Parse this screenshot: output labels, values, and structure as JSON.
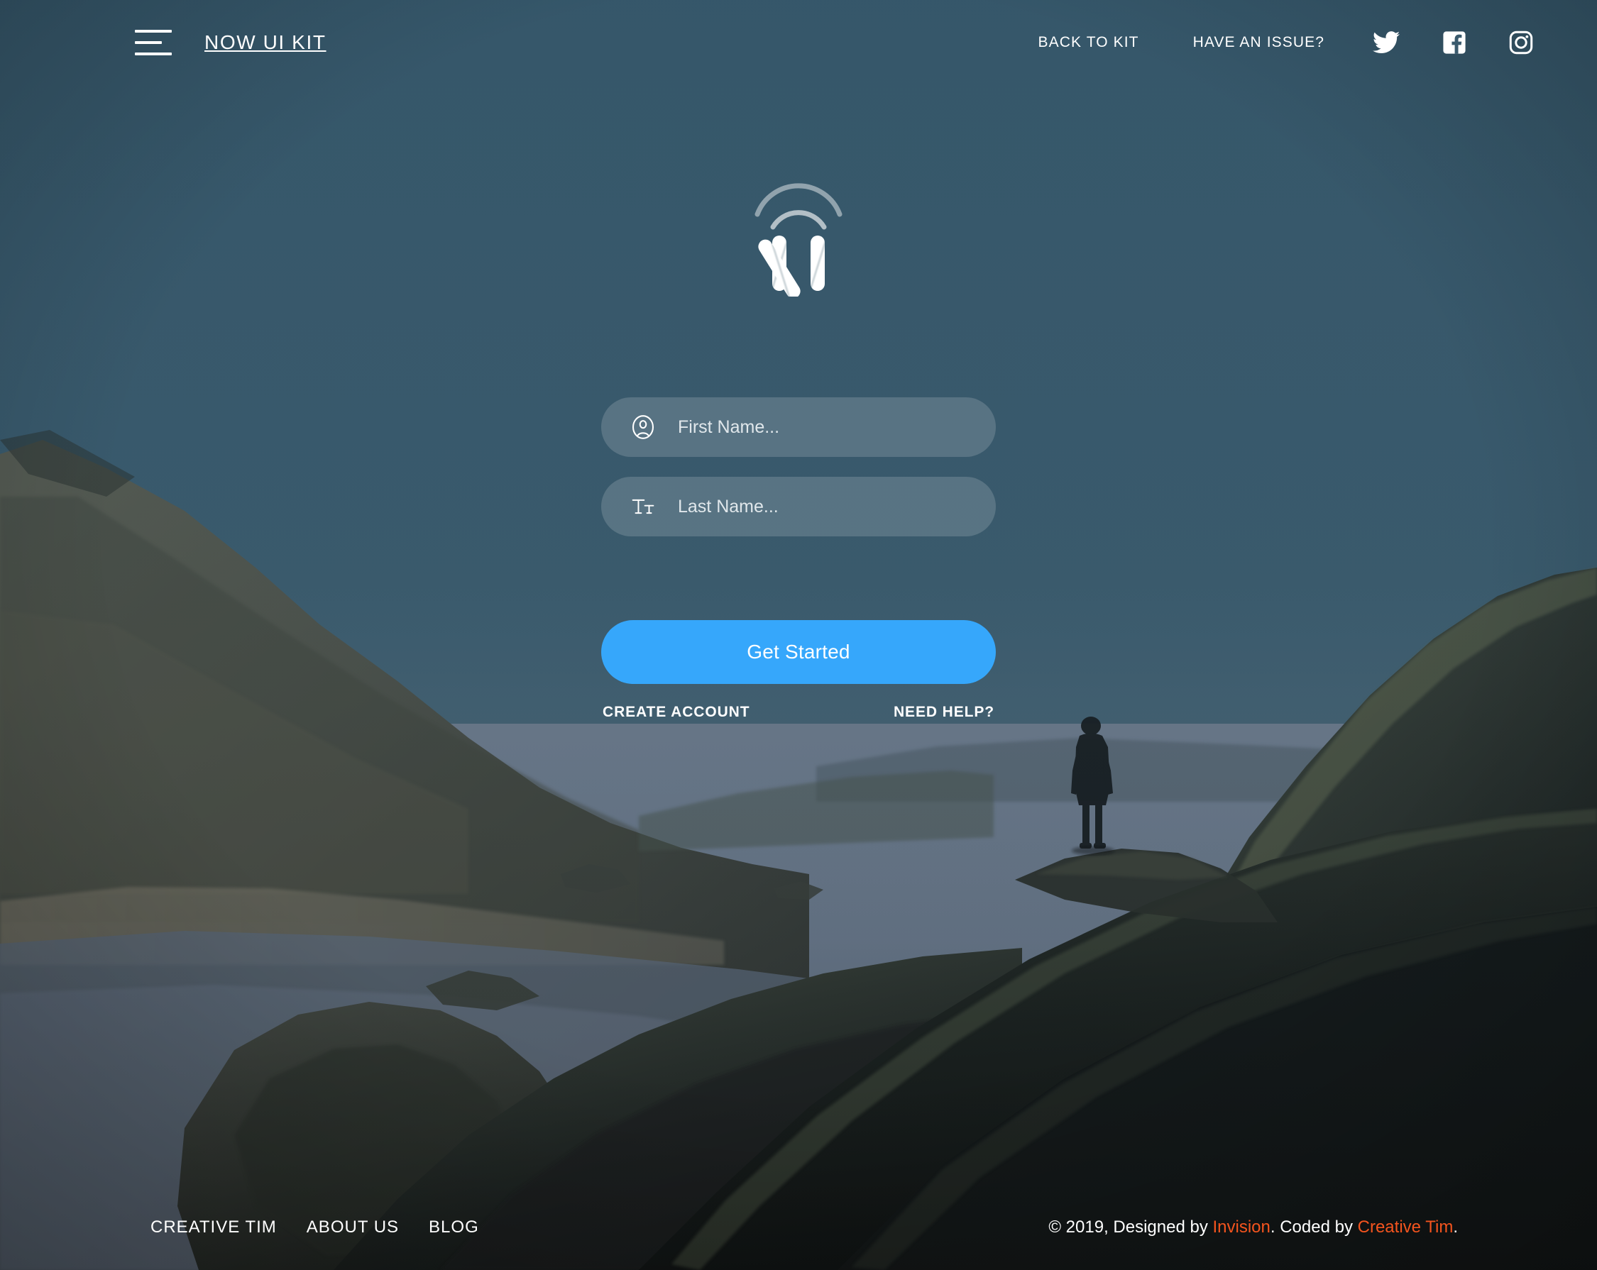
{
  "navbar": {
    "brand": "NOW UI KIT",
    "menu_icon": "hamburger-icon",
    "links": [
      {
        "label": "BACK TO KIT"
      },
      {
        "label": "HAVE AN ISSUE?"
      }
    ],
    "social": [
      {
        "name": "twitter-icon"
      },
      {
        "name": "facebook-icon"
      },
      {
        "name": "instagram-icon"
      }
    ]
  },
  "logo": {
    "name": "now-ui-kit-logo",
    "letter": "N"
  },
  "form": {
    "first_name": {
      "placeholder": "First Name...",
      "value": "",
      "icon": "user-circle-icon"
    },
    "last_name": {
      "placeholder": "Last Name...",
      "value": "",
      "icon": "text-format-icon"
    },
    "submit_label": "Get Started",
    "submit_color": "#36a7fb",
    "links": [
      {
        "label": "CREATE ACCOUNT"
      },
      {
        "label": "NEED HELP?"
      }
    ]
  },
  "footer": {
    "links": [
      {
        "label": "CREATIVE TIM"
      },
      {
        "label": "ABOUT US"
      },
      {
        "label": "BLOG"
      }
    ],
    "copyright": {
      "prefix": "© 2019, Designed by ",
      "designer": "Invision",
      "middle": ". Coded by ",
      "coder": "Creative Tim",
      "suffix": ".",
      "accent_color": "#f4541e"
    }
  },
  "theme": {
    "sky": "#3a5a6d",
    "water": "#6a7787",
    "cliff": "#4b4d43",
    "dark_ridge": "#161a18",
    "text": "#ffffff"
  }
}
